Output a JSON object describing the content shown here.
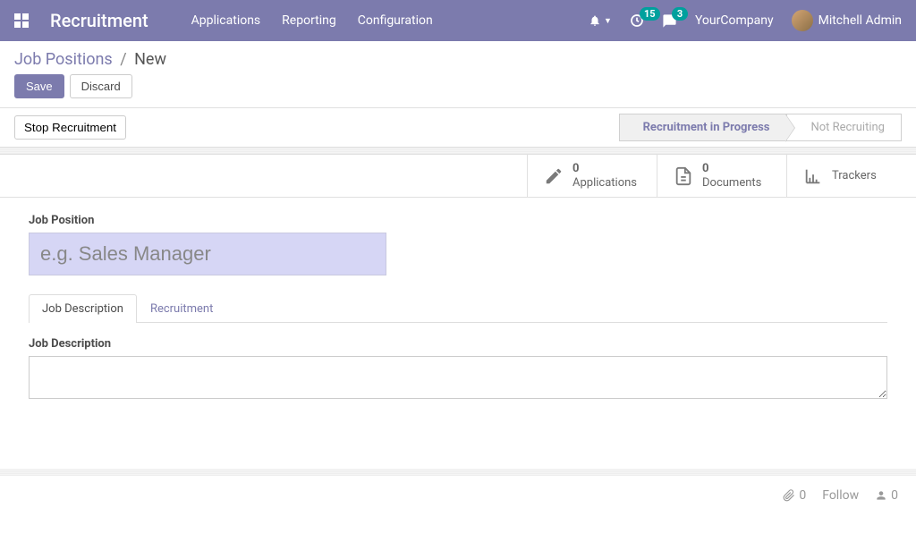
{
  "topbar": {
    "brand": "Recruitment",
    "menu": [
      "Applications",
      "Reporting",
      "Configuration"
    ],
    "activities_badge": "15",
    "messages_badge": "3",
    "company": "YourCompany",
    "user": "Mitchell Admin"
  },
  "breadcrumb": {
    "parent": "Job Positions",
    "current": "New"
  },
  "actions": {
    "save": "Save",
    "discard": "Discard"
  },
  "statusbar": {
    "button": "Stop Recruitment",
    "stages": [
      "Recruitment in Progress",
      "Not Recruiting"
    ]
  },
  "stats": {
    "applications": {
      "count": "0",
      "label": "Applications"
    },
    "documents": {
      "count": "0",
      "label": "Documents"
    },
    "trackers": {
      "label": "Trackers"
    }
  },
  "form": {
    "position_label": "Job Position",
    "position_placeholder": "e.g. Sales Manager",
    "position_value": ""
  },
  "tabs": {
    "desc": "Job Description",
    "recruit": "Recruitment"
  },
  "tab_content": {
    "desc_label": "Job Description",
    "desc_value": ""
  },
  "chatter": {
    "attachments": "0",
    "follow": "Follow",
    "followers": "0"
  }
}
